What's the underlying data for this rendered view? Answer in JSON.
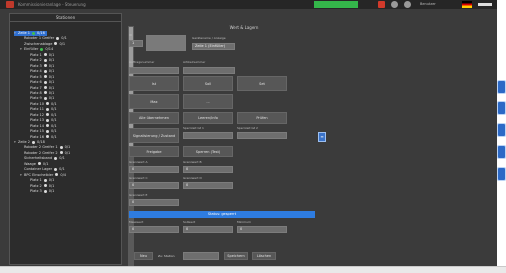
{
  "titlebar": {
    "app_title": "Kommissionieranlage - Steuerung",
    "green_status": "",
    "user": "Benutzer"
  },
  "tree": {
    "header": "Stationen",
    "rows": [
      {
        "label": "Zeile 1",
        "status": "0/16",
        "selected": true,
        "indent": 0,
        "toggle": "▾",
        "dot": "green"
      },
      {
        "label": "Roboter 1 Greifer",
        "status": "0/1",
        "indent": 1,
        "toggle": "",
        "dot": "white"
      },
      {
        "label": "Zwischenablage",
        "status": "0/1",
        "indent": 1,
        "toggle": "",
        "dot": "white"
      },
      {
        "label": "Einfüller",
        "status": "0/14",
        "indent": 1,
        "toggle": "▾",
        "dot": "green"
      },
      {
        "label": "Platz 1",
        "status": "0/1",
        "indent": 2,
        "toggle": "",
        "dot": "white"
      },
      {
        "label": "Platz 2",
        "status": "0/1",
        "indent": 2,
        "toggle": "",
        "dot": "white"
      },
      {
        "label": "Platz 3",
        "status": "0/1",
        "indent": 2,
        "toggle": "",
        "dot": "white"
      },
      {
        "label": "Platz 4",
        "status": "0/1",
        "indent": 2,
        "toggle": "",
        "dot": "white"
      },
      {
        "label": "Platz 5",
        "status": "0/1",
        "indent": 2,
        "toggle": "",
        "dot": "white"
      },
      {
        "label": "Platz 6",
        "status": "0/1",
        "indent": 2,
        "toggle": "",
        "dot": "white"
      },
      {
        "label": "Platz 7",
        "status": "0/1",
        "indent": 2,
        "toggle": "",
        "dot": "white"
      },
      {
        "label": "Platz 8",
        "status": "0/1",
        "indent": 2,
        "toggle": "",
        "dot": "white"
      },
      {
        "label": "Platz 9",
        "status": "0/1",
        "indent": 2,
        "toggle": "",
        "dot": "white"
      },
      {
        "label": "Platz 10",
        "status": "0/1",
        "indent": 2,
        "toggle": "",
        "dot": "white"
      },
      {
        "label": "Platz 11",
        "status": "0/1",
        "indent": 2,
        "toggle": "",
        "dot": "white"
      },
      {
        "label": "Platz 12",
        "status": "0/1",
        "indent": 2,
        "toggle": "",
        "dot": "white"
      },
      {
        "label": "Platz 13",
        "status": "0/1",
        "indent": 2,
        "toggle": "",
        "dot": "white"
      },
      {
        "label": "Platz 14",
        "status": "0/1",
        "indent": 2,
        "toggle": "",
        "dot": "white"
      },
      {
        "label": "Platz 15",
        "status": "0/1",
        "indent": 2,
        "toggle": "",
        "dot": "white"
      },
      {
        "label": "Platz 16",
        "status": "0/1",
        "indent": 2,
        "toggle": "",
        "dot": "white"
      },
      {
        "label": "Zeile 2",
        "status": "0/18",
        "indent": 0,
        "toggle": "▾",
        "dot": "white"
      },
      {
        "label": "Roboter 2 Greifer 1",
        "status": "0/1",
        "indent": 1,
        "toggle": "",
        "dot": "white"
      },
      {
        "label": "Roboter 2 Greifer 2",
        "status": "0/1",
        "indent": 1,
        "toggle": "",
        "dot": "white"
      },
      {
        "label": "Sicherheitsband",
        "status": "0/1",
        "indent": 1,
        "toggle": "",
        "dot": "white"
      },
      {
        "label": "Waage",
        "status": "0/1",
        "indent": 1,
        "toggle": "",
        "dot": "white"
      },
      {
        "label": "Container Lager",
        "status": "0/1",
        "indent": 1,
        "toggle": "",
        "dot": "white"
      },
      {
        "label": "BPC Einscheibler",
        "status": "0/4",
        "indent": 1,
        "toggle": "▾",
        "dot": "white"
      },
      {
        "label": "Platz 1",
        "status": "0/1",
        "indent": 2,
        "toggle": "",
        "dot": "white"
      },
      {
        "label": "Platz 2",
        "status": "0/1",
        "indent": 2,
        "toggle": "",
        "dot": "white"
      },
      {
        "label": "Platz 3",
        "status": "0/1",
        "indent": 2,
        "toggle": "",
        "dot": "white"
      }
    ]
  },
  "form": {
    "header": "Wert & Lagern",
    "id_label": "ID",
    "id_value": "1",
    "name_label": "Gerätename / Anzeige",
    "name_value": "Zeile 1 (Einfüller)",
    "field_a_label": "Auftragsnummer",
    "field_b_label": "Artikelnummer",
    "buttons_row1": [
      "Ist",
      "Soll",
      "Set"
    ],
    "buttons_row2": [
      "Max",
      "..."
    ],
    "buttons_row3": [
      "Alle übernehmen",
      "Leeren/Info",
      "Prüfen"
    ],
    "flags_a_label": "Signalisierung / Zustand",
    "flags_b_label": "Sperrzeit Ist 1",
    "flags_c_label": "Sperrzeit Ist 2",
    "btn_freigabe": "Freigabe",
    "btn_sperren": "Sperren (Test)",
    "grenz_a_label": "Grenzwert A",
    "grenz_b_label": "Grenzwert B",
    "grenz_c_label": "Grenzwert C",
    "grenz_d_label": "Grenzwert D",
    "grenz_e_label": "Grenzwert E",
    "grenz_a_value": "0",
    "grenz_b_value": "0",
    "grenz_c_value": "0",
    "grenz_d_value": "0",
    "grenz_e_value": "0",
    "blue_bar": "Status: gesperrt",
    "bottom_l1": "Messwert",
    "bottom_l2": "Sollwert",
    "bottom_l3": "Minimum",
    "bottom_v1": "0",
    "bottom_v2": "0",
    "bottom_v3": "0",
    "side_btn": "≡",
    "footer_btn1": "Neu",
    "footer_label": "Zu: Station",
    "footer_btn2": "Speichern",
    "footer_btn3": "Löschen"
  },
  "colors": {
    "accent": "#2e7ce0",
    "status_green": "#34b64a",
    "panel": "#3b3b3b"
  },
  "icons": {
    "edge": [
      "tool-icon",
      "tool-icon",
      "tool-icon",
      "tool-icon",
      "tool-icon"
    ]
  }
}
